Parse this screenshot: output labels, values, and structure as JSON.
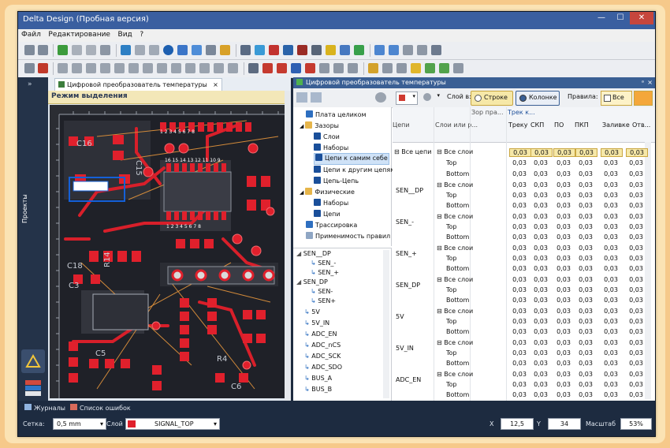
{
  "window": {
    "title": "Delta Design (Пробная версия)"
  },
  "menu": [
    "Файл",
    "Редактирование",
    "Вид",
    "?"
  ],
  "left_strip": {
    "label": "Проекты"
  },
  "pcb_panel": {
    "tab_title": "Цифровой преобразователь температуры",
    "mode_label": "Режим выделения",
    "silk_labels": [
      "C16",
      "C15",
      "R14",
      "C18",
      "R4",
      "C5",
      "C3",
      "C6"
    ],
    "pin_numbers": [
      "16 15 14 13 12 11 10 9",
      "1 2 3 4 5 6 7 8",
      "1 2 3 4 5 6 7 8"
    ]
  },
  "rules_panel": {
    "title": "Цифровой преобразователь температуры",
    "layer_label": "Слой в:",
    "radio_row": "Строке",
    "radio_col": "Колонке",
    "rules_label": "Правила:",
    "rules_all": "Все",
    "tree": [
      {
        "label": "Плата целиком",
        "level": 0
      },
      {
        "label": "Зазоры",
        "level": 0
      },
      {
        "label": "Слои",
        "level": 1
      },
      {
        "label": "Наборы",
        "level": 1
      },
      {
        "label": "Цепи к самим себе",
        "level": 1,
        "selected": true
      },
      {
        "label": "Цепи к другим цепям",
        "level": 1
      },
      {
        "label": "Цепь-Цепь",
        "level": 1
      },
      {
        "label": "Физические",
        "level": 0
      },
      {
        "label": "Наборы",
        "level": 1
      },
      {
        "label": "Цепи",
        "level": 1
      },
      {
        "label": "Трассировка",
        "level": 0
      },
      {
        "label": "Применимость правил",
        "level": 0
      }
    ],
    "nets": [
      "SEN__DP",
      "SEN_-",
      "SEN_+",
      "SEN_DP",
      "SEN-",
      "SEN+",
      "5V",
      "5V_IN",
      "ADC_EN",
      "ADC_nCS",
      "ADC_SCK",
      "ADC_SDO",
      "BUS_A",
      "BUS_B"
    ],
    "grid": {
      "col_nets": "Цепи",
      "col_layers": "Слои или р...",
      "col_group": "Зор пра...",
      "col_track": "Трек к...",
      "columns": [
        "Треку",
        "СКП",
        "ПО",
        "ПКП",
        "Заливке",
        "Отв..."
      ],
      "all_nets": "Все цепи",
      "all_layers": "Все слои",
      "top": "Top",
      "bottom": "Bottom",
      "value": "0,03",
      "row_nets": [
        "SEN__DP",
        "SEN_-",
        "SEN_+",
        "SEN_DP",
        "5V",
        "5V_IN",
        "ADC_EN",
        "ADC_nCS"
      ]
    }
  },
  "bottom_tabs": {
    "journals": "Журналы",
    "errors": "Список ошибок"
  },
  "status": {
    "grid_label": "Сетка:",
    "grid_value": "0,5 mm",
    "layer_label": "Слой",
    "layer_value": "SIGNAL_TOP",
    "x_label": "X",
    "x_value": "12,5",
    "y_label": "Y",
    "y_value": "34",
    "scale_label": "Масштаб",
    "scale_value": "53%"
  },
  "colors": {
    "pcb_bg": "#1f2128",
    "pad": "#e0202c",
    "track": "#d81f2a",
    "accent": "#3a5f94",
    "highlight": "#f6e8a8"
  }
}
